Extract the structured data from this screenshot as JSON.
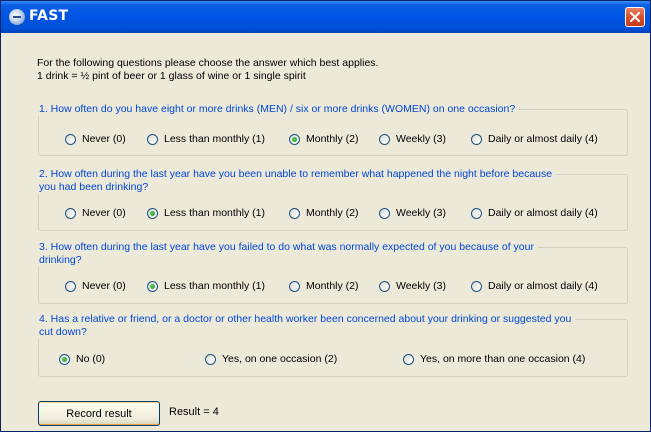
{
  "window": {
    "title": "FAST"
  },
  "intro": {
    "line1": "For the following questions please choose the answer which best applies.",
    "line2": "1 drink = ½ pint of beer or 1 glass of wine or 1 single spirit"
  },
  "questions": [
    {
      "line1": "1.  How often do you have eight or more drinks (MEN) / six or more drinks (WOMEN) on one occasion?",
      "line2": "",
      "options": [
        "Never (0)",
        "Less than monthly (1)",
        "Monthly (2)",
        "Weekly (3)",
        "Daily or almost daily (4)"
      ],
      "selected": "Monthly (2)"
    },
    {
      "line1": "2.  How often during the last year have you been unable to remember what happened the night before because",
      "line2": "you had been drinking?",
      "options": [
        "Never (0)",
        "Less than monthly (1)",
        "Monthly (2)",
        "Weekly (3)",
        "Daily or almost daily (4)"
      ],
      "selected": "Less than monthly (1)"
    },
    {
      "line1": "3.  How often during the last year have you failed to do what was normally expected of you because of your",
      "line2": "drinking?",
      "options": [
        "Never (0)",
        "Less than monthly (1)",
        "Monthly (2)",
        "Weekly (3)",
        "Daily or almost daily (4)"
      ],
      "selected": "Less than monthly (1)"
    },
    {
      "line1": "4.  Has a relative or friend, or a doctor or other health worker been concerned about your drinking or suggested you",
      "line2": "cut down?",
      "options": [
        "No (0)",
        "Yes, on one occasion (2)",
        "Yes, on more than one occasion (4)"
      ],
      "selected": "No (0)"
    }
  ],
  "footer": {
    "record_label": "Record result",
    "result_text": "Result = 4"
  },
  "icons": {
    "app": "fast-app-icon",
    "close": "close-icon"
  },
  "colors": {
    "titlebar": "#0054e3",
    "legend_text": "#0046d5",
    "close": "#d6502e"
  }
}
